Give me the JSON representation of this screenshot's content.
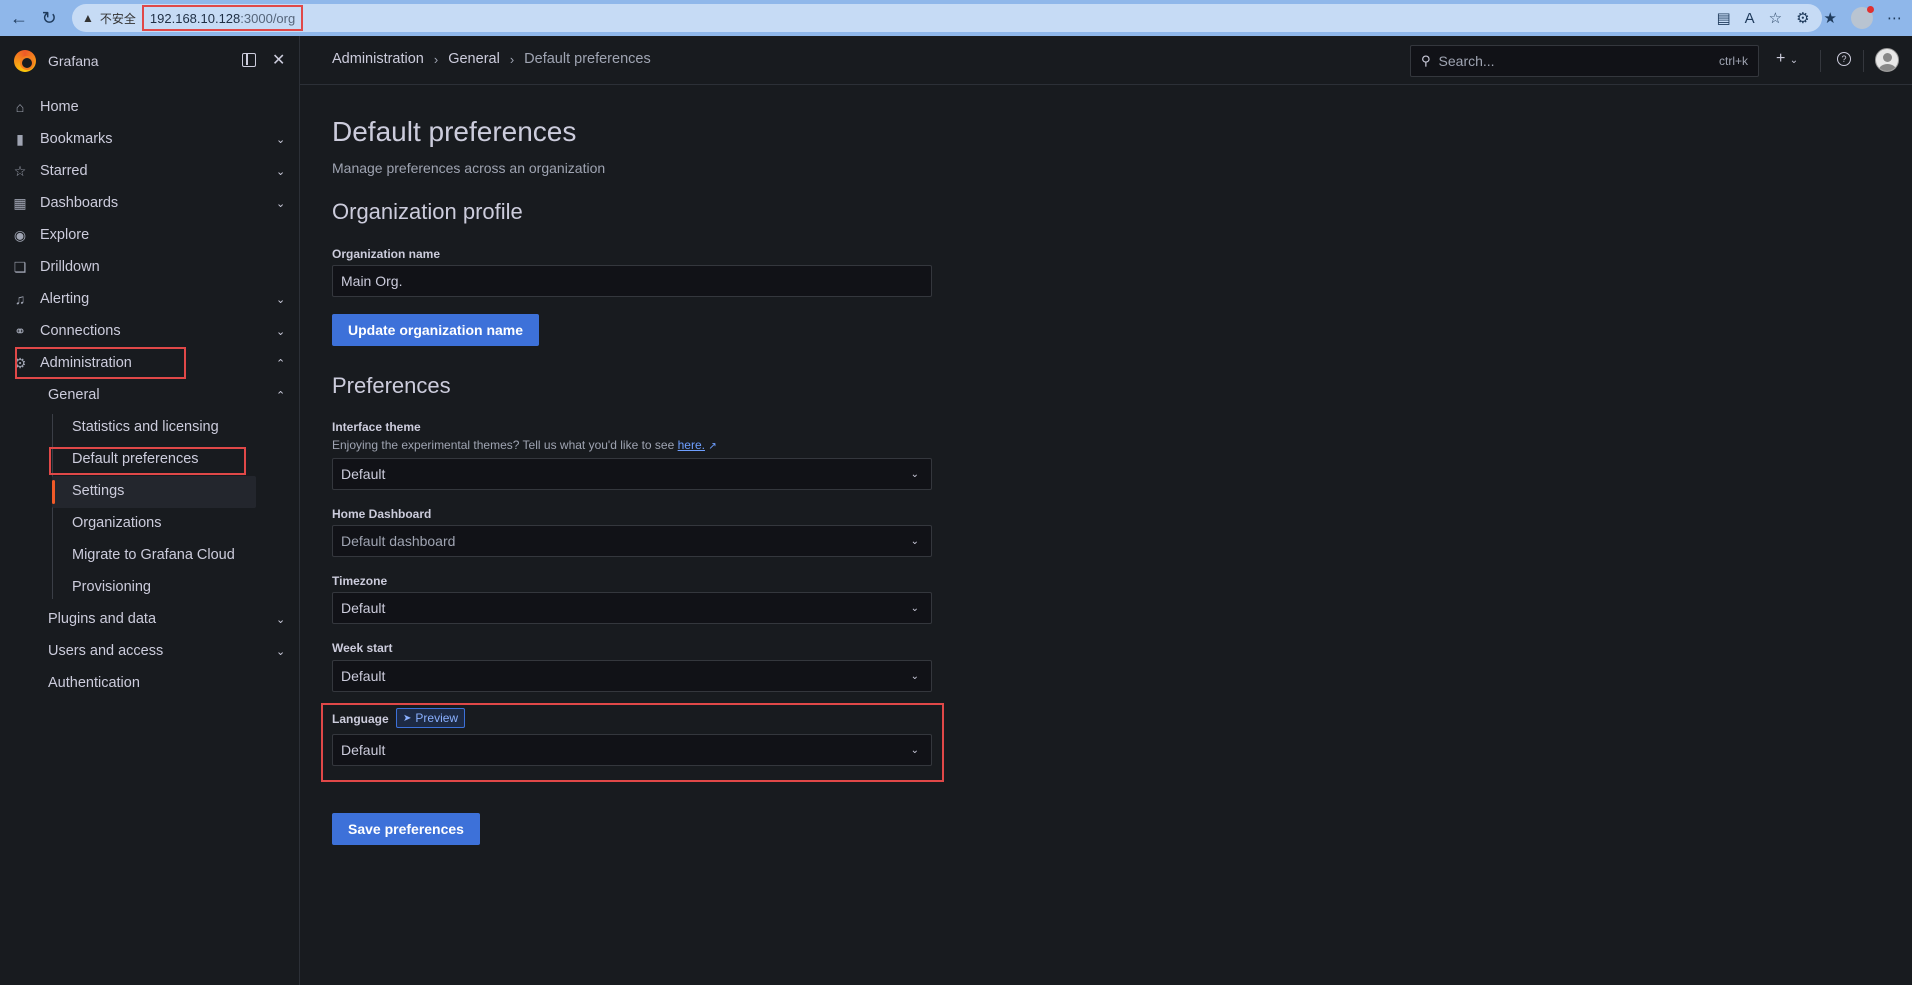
{
  "browser": {
    "insecure_label": "不安全",
    "url_host": "192.168.10.128",
    "url_path": ":3000/org"
  },
  "sidebar": {
    "brand": "Grafana",
    "items": [
      {
        "label": "Home",
        "icon": "home-icon"
      },
      {
        "label": "Bookmarks",
        "icon": "bookmark-icon"
      },
      {
        "label": "Starred",
        "icon": "star-icon"
      },
      {
        "label": "Dashboards",
        "icon": "apps-icon"
      },
      {
        "label": "Explore",
        "icon": "compass-icon"
      },
      {
        "label": "Drilldown",
        "icon": "drilldown-icon"
      },
      {
        "label": "Alerting",
        "icon": "bell-icon"
      },
      {
        "label": "Connections",
        "icon": "connections-icon"
      },
      {
        "label": "Administration",
        "icon": "cog-icon"
      }
    ],
    "sub_items": {
      "general": "General",
      "plugins": "Plugins and data",
      "users": "Users and access",
      "auth": "Authentication"
    },
    "general_items": [
      "Statistics and licensing",
      "Default preferences",
      "Settings",
      "Organizations",
      "Migrate to Grafana Cloud",
      "Provisioning"
    ]
  },
  "topbar": {
    "breadcrumbs": [
      "Administration",
      "General",
      "Default preferences"
    ],
    "search_placeholder": "Search...",
    "search_shortcut": "ctrl+k"
  },
  "page": {
    "title": "Default preferences",
    "subtitle": "Manage preferences across an organization",
    "org_section": "Organization profile",
    "org_name_label": "Organization name",
    "org_name_value": "Main Org.",
    "update_button": "Update organization name",
    "prefs_section": "Preferences",
    "theme_label": "Interface theme",
    "theme_desc": "Enjoying the experimental themes? Tell us what you'd like to see",
    "theme_link": "here.",
    "theme_value": "Default",
    "home_label": "Home Dashboard",
    "home_value": "Default dashboard",
    "tz_label": "Timezone",
    "tz_value": "Default",
    "week_label": "Week start",
    "week_value": "Default",
    "lang_label": "Language",
    "lang_badge": "Preview",
    "lang_value": "Default",
    "save_button": "Save preferences"
  },
  "colors": {
    "accent": "#3d71d9",
    "highlight": "#e04848",
    "background": "#181b1f"
  }
}
